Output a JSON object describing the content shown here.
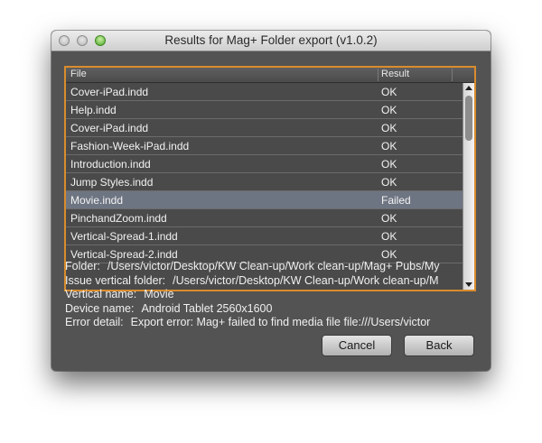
{
  "window": {
    "title": "Results for Mag+ Folder export (v1.0.2)"
  },
  "table": {
    "columns": {
      "file": "File",
      "result": "Result"
    },
    "rows": [
      {
        "file": "Cover-iPad.indd",
        "result": "OK"
      },
      {
        "file": "Help.indd",
        "result": "OK"
      },
      {
        "file": "Cover-iPad.indd",
        "result": "OK"
      },
      {
        "file": "Fashion-Week-iPad.indd",
        "result": "OK"
      },
      {
        "file": "Introduction.indd",
        "result": "OK"
      },
      {
        "file": "Jump Styles.indd",
        "result": "OK"
      },
      {
        "file": "Movie.indd",
        "result": "Failed"
      },
      {
        "file": "PinchandZoom.indd",
        "result": "OK"
      },
      {
        "file": "Vertical-Spread-1.indd",
        "result": "OK"
      },
      {
        "file": "Vertical-Spread-2.indd",
        "result": "OK"
      }
    ],
    "selected_index": 6
  },
  "details": {
    "folder_label": "Folder:",
    "folder_value": "/Users/victor/Desktop/KW Clean-up/Work clean-up/Mag+ Pubs/My",
    "issue_label": "Issue vertical folder:",
    "issue_value": "/Users/victor/Desktop/KW Clean-up/Work clean-up/M",
    "vertical_label": "Vertical name:",
    "vertical_value": "Movie",
    "device_label": "Device name:",
    "device_value": "Android Tablet 2560x1600",
    "error_label": "Error detail:",
    "error_value": "Export error: Mag+ failed to find media file file:///Users/victor"
  },
  "buttons": {
    "cancel": "Cancel",
    "back": "Back"
  },
  "colors": {
    "accent_border": "#d98c2d",
    "selected_row": "#6e7582"
  }
}
